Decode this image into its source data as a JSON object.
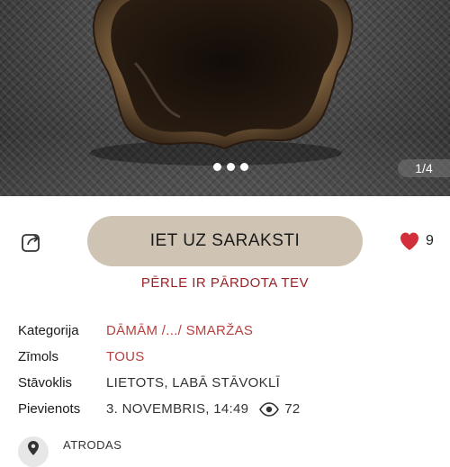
{
  "gallery": {
    "counter": "1/4",
    "dots": 3
  },
  "actions": {
    "share_icon": "share-arrow-icon",
    "cta_label": "IET UZ SARAKSTI",
    "favorite_icon": "heart-icon",
    "favorite_count": "9"
  },
  "status": {
    "sold_text": "PĒRLE IR PĀRDOTA TEV"
  },
  "details": {
    "category_label": "Kategorija",
    "category_value": "DĀMĀM /.../ SMARŽAS",
    "brand_label": "Zīmols",
    "brand_value": "TOUS",
    "condition_label": "Stāvoklis",
    "condition_value": "LIETOTS, LABĀ STĀVOKLĪ",
    "added_label": "Pievienots",
    "added_value": "3. NOVEMBRIS, 14:49",
    "views_icon": "eye-icon",
    "views_count": "72"
  },
  "location": {
    "title": "ATRODAS",
    "icon": "location-pin-icon"
  },
  "colors": {
    "cta_bg": "#cfc4b3",
    "accent_red": "#9b2226",
    "link_red": "#b5413f",
    "heart": "#d32f3a"
  }
}
